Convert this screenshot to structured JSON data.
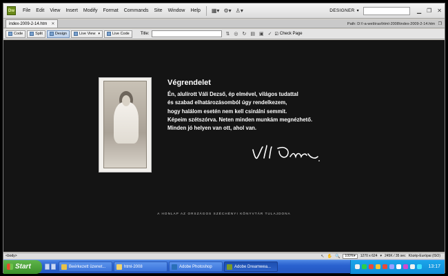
{
  "app": {
    "logo": "Dw",
    "menus": [
      "File",
      "Edit",
      "View",
      "Insert",
      "Modify",
      "Format",
      "Commands",
      "Site",
      "Window",
      "Help"
    ],
    "workspace": "DESIGNER"
  },
  "document": {
    "tab": "index-2009-2-14.htm",
    "path": "Path:  D:\\!-a-web\\ras\\html-2008\\index-2009-2-14.htm"
  },
  "toolbar": {
    "code": "Code",
    "split": "Split",
    "design": "Design",
    "live_view": "Live View",
    "live_code": "Live Code",
    "title_label": "Title:",
    "title_value": "",
    "check_page": "Check Page"
  },
  "page": {
    "heading": "Végrendelet",
    "lines": [
      "Én, alulírott Váli Dezső, ép elmével, világos tudattal",
      "és szabad elhatározásomból úgy rendelkezem,",
      "hogy halálom esetén nem kell csinálni semmit.",
      "Képeim szétszórva. Neten minden munkám megnézhető.",
      "Minden jó helyen van ott, ahol van."
    ],
    "footer": "A HONLAP AZ ORSZÁGOS SZÉCHÉNYI KÖNYVTÁR TULAJDONA"
  },
  "status": {
    "tag": "<body>",
    "zoom": "100%",
    "size": "1270 x 624",
    "weight": "245K / 35 sec",
    "encoding": "Közép-Európai (ISO)"
  },
  "taskbar": {
    "start": "Start",
    "tasks": [
      {
        "label": "Beérkezett üzenet...",
        "color": "#e8c24a"
      },
      {
        "label": "html-2008",
        "color": "#f2d36a"
      },
      {
        "label": "Adobe Photoshop",
        "color": "#2a6fb8"
      },
      {
        "label": "Adobe Dreamwea...",
        "color": "#7a9a2a"
      }
    ],
    "clock": "13:17"
  }
}
